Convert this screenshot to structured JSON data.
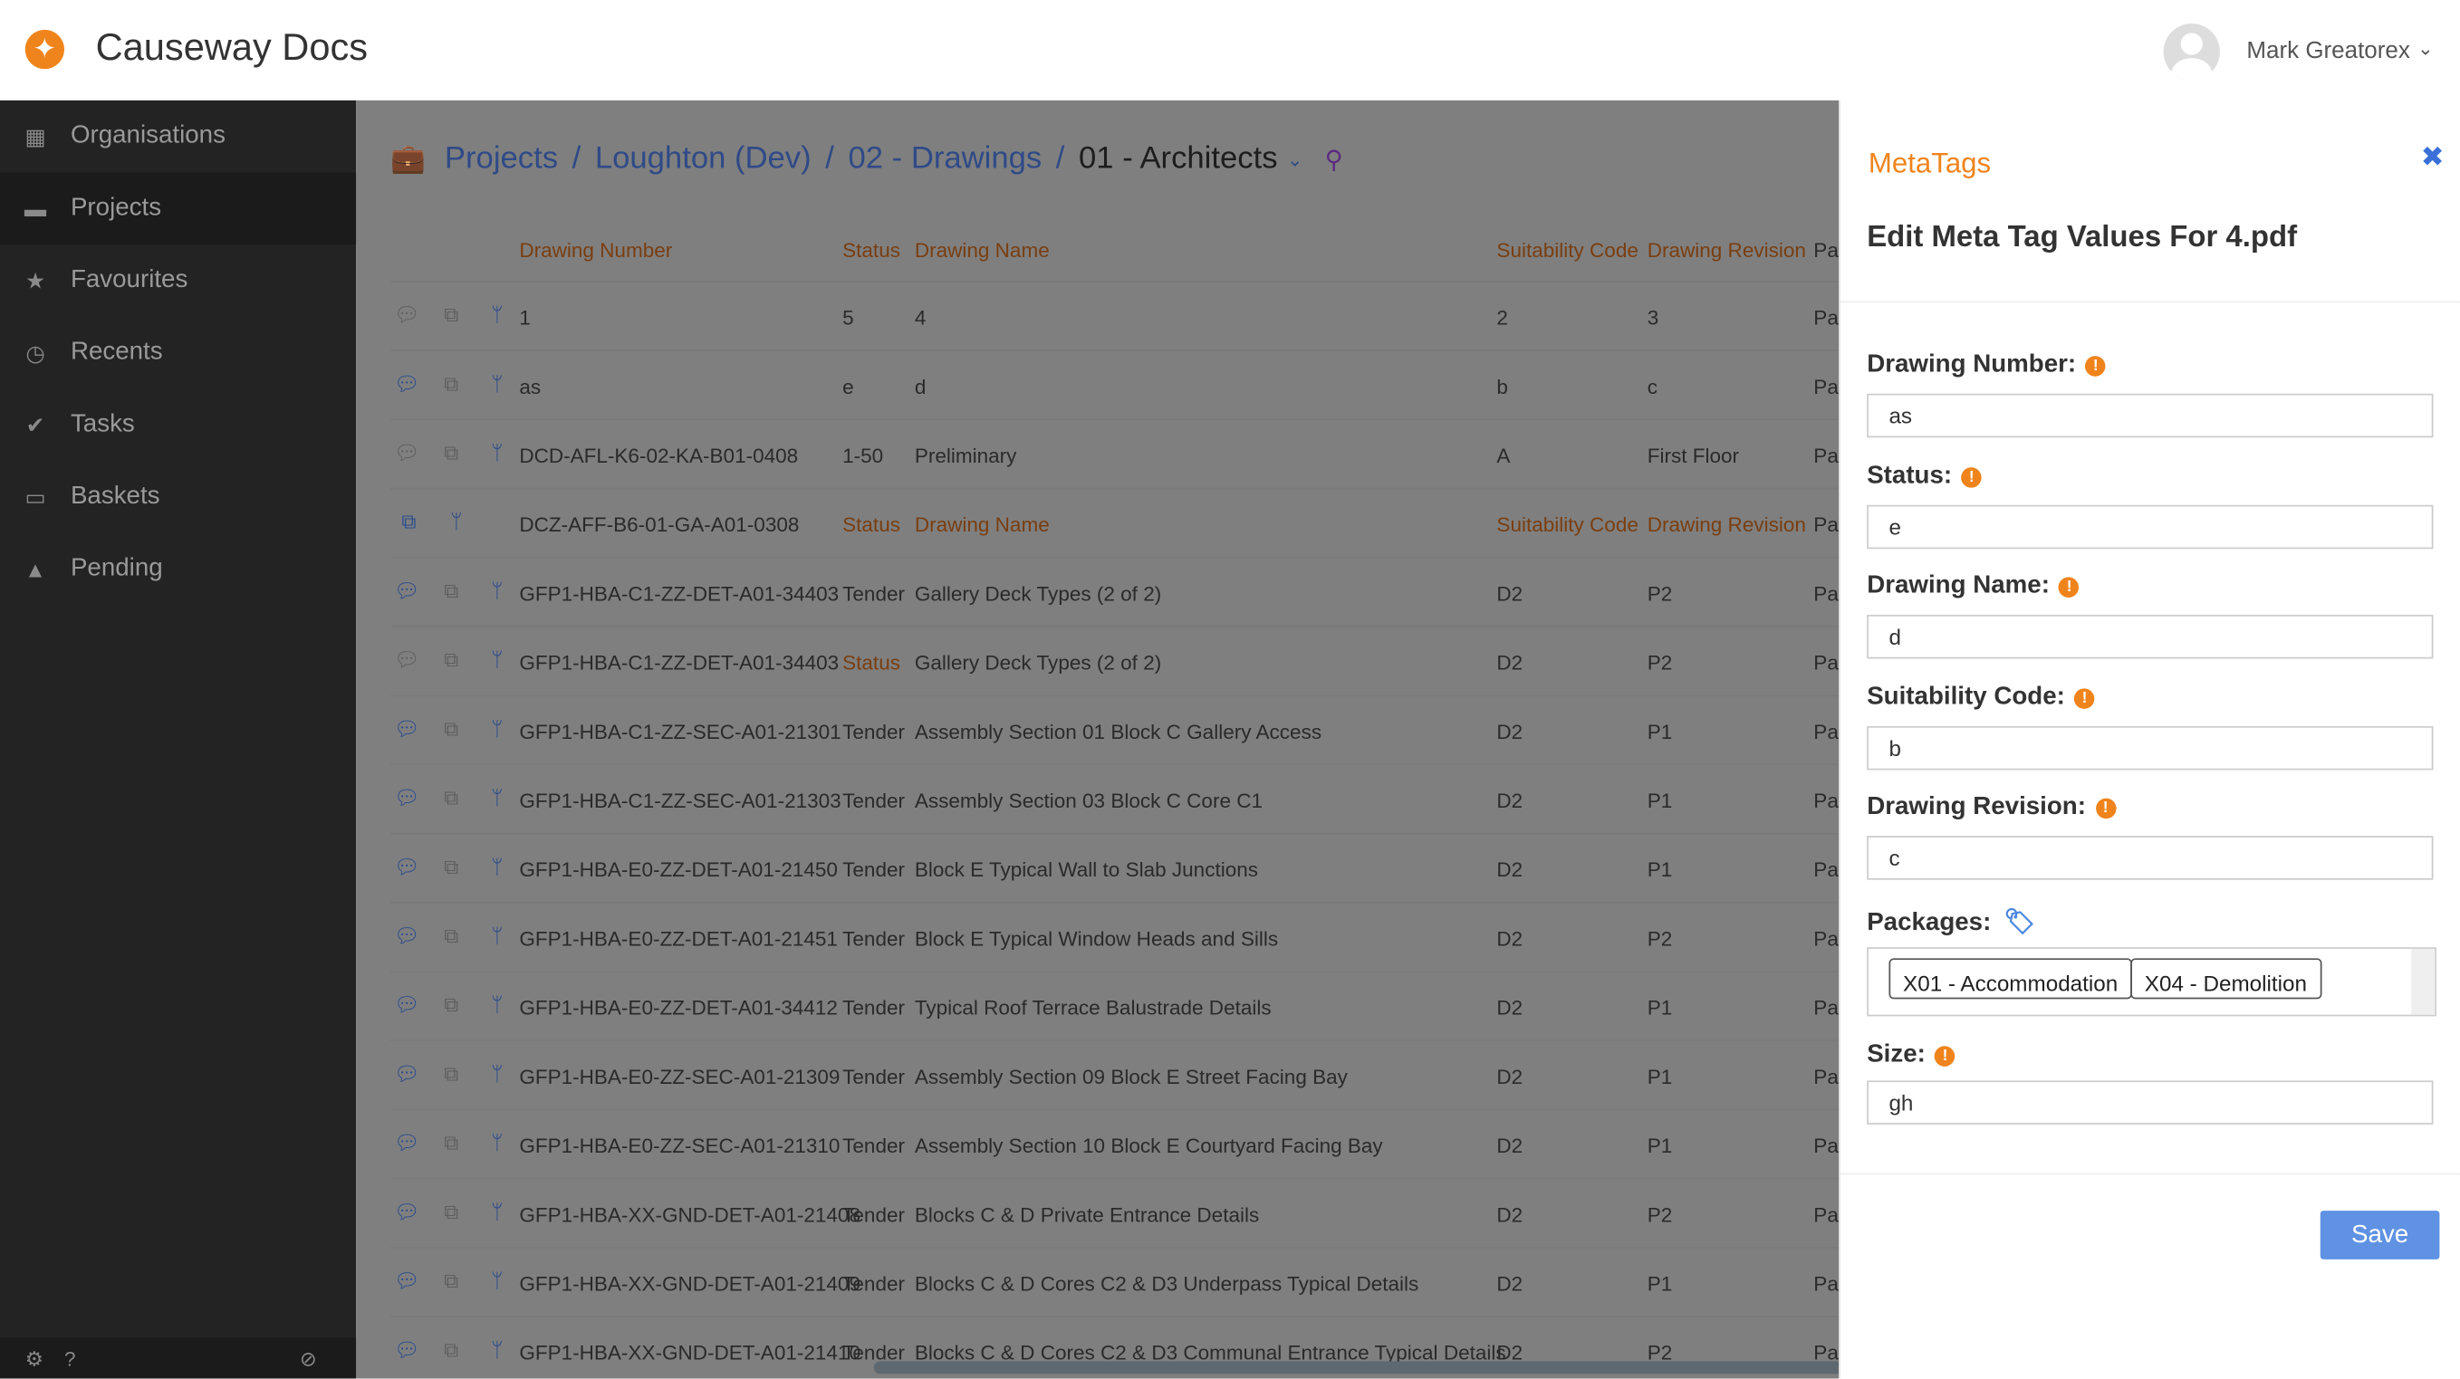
{
  "app": {
    "title": "Causeway Docs",
    "user": "Mark Greatorex"
  },
  "sidebar": {
    "items": [
      {
        "label": "Organisations",
        "icon": "building-icon"
      },
      {
        "label": "Projects",
        "icon": "briefcase-icon",
        "active": true
      },
      {
        "label": "Favourites",
        "icon": "star-icon"
      },
      {
        "label": "Recents",
        "icon": "clock-icon"
      },
      {
        "label": "Tasks",
        "icon": "check-icon"
      },
      {
        "label": "Baskets",
        "icon": "inbox-icon"
      },
      {
        "label": "Pending",
        "icon": "warning-icon"
      }
    ]
  },
  "breadcrumb": {
    "items": [
      "Projects",
      "Loughton (Dev)",
      "02 - Drawings"
    ],
    "current": "01 - Architects"
  },
  "table": {
    "columns": [
      "Drawing Number",
      "Status",
      "Drawing Name",
      "Suitability Code",
      "Drawing Revision",
      "Pa"
    ],
    "rows": [
      {
        "chat": "gray",
        "cells": [
          "1",
          "5",
          "4",
          "2",
          "3",
          "Pa"
        ]
      },
      {
        "chat": "blue",
        "cells": [
          "as",
          "e",
          "d",
          "b",
          "c",
          "Pa"
        ]
      },
      {
        "chat": "gray",
        "cells": [
          "DCD-AFL-K6-02-KA-B01-0408",
          "1-50",
          "Preliminary",
          "A",
          "First Floor",
          "Pa"
        ]
      },
      {
        "chat": "none",
        "cells": [
          "DCZ-AFF-B6-01-GA-A01-0308",
          "Status",
          "Drawing Name",
          "Suitability Code",
          "Drawing Revision",
          "Pa"
        ],
        "orange": [
          1,
          2,
          3,
          4
        ]
      },
      {
        "chat": "blue",
        "cells": [
          "GFP1-HBA-C1-ZZ-DET-A01-34403",
          "Tender",
          "Gallery Deck Types (2 of 2)",
          "D2",
          "P2",
          "Pa"
        ]
      },
      {
        "chat": "gray",
        "cells": [
          "GFP1-HBA-C1-ZZ-DET-A01-34403",
          "Status",
          "Gallery Deck Types (2 of 2)",
          "D2",
          "P2",
          "Pa"
        ],
        "orange": [
          1
        ]
      },
      {
        "chat": "blue",
        "cells": [
          "GFP1-HBA-C1-ZZ-SEC-A01-21301",
          "Tender",
          "Assembly Section 01 Block C Gallery Access",
          "D2",
          "P1",
          "Pa"
        ]
      },
      {
        "chat": "blue",
        "cells": [
          "GFP1-HBA-C1-ZZ-SEC-A01-21303",
          "Tender",
          "Assembly Section 03 Block C Core C1",
          "D2",
          "P1",
          "Pa"
        ]
      },
      {
        "chat": "blue",
        "cells": [
          "GFP1-HBA-E0-ZZ-DET-A01-21450",
          "Tender",
          "Block E Typical Wall to Slab Junctions",
          "D2",
          "P1",
          "Pa"
        ]
      },
      {
        "chat": "blue",
        "cells": [
          "GFP1-HBA-E0-ZZ-DET-A01-21451",
          "Tender",
          "Block E Typical Window Heads and Sills",
          "D2",
          "P2",
          "Pa"
        ]
      },
      {
        "chat": "blue",
        "cells": [
          "GFP1-HBA-E0-ZZ-DET-A01-34412",
          "Tender",
          "Typical Roof Terrace Balustrade Details",
          "D2",
          "P1",
          "Pa"
        ]
      },
      {
        "chat": "blue",
        "cells": [
          "GFP1-HBA-E0-ZZ-SEC-A01-21309",
          "Tender",
          "Assembly Section 09 Block E Street Facing Bay",
          "D2",
          "P1",
          "Pa"
        ]
      },
      {
        "chat": "blue",
        "cells": [
          "GFP1-HBA-E0-ZZ-SEC-A01-21310",
          "Tender",
          "Assembly Section 10 Block E Courtyard Facing Bay",
          "D2",
          "P1",
          "Pa"
        ]
      },
      {
        "chat": "blue",
        "cells": [
          "GFP1-HBA-XX-GND-DET-A01-21408",
          "Tender",
          "Blocks C & D Private Entrance Details",
          "D2",
          "P2",
          "Pa"
        ]
      },
      {
        "chat": "blue",
        "cells": [
          "GFP1-HBA-XX-GND-DET-A01-21409",
          "Tender",
          "Blocks C & D Cores C2 & D3 Underpass Typical Details",
          "D2",
          "P1",
          "Pa"
        ]
      },
      {
        "chat": "blue",
        "cells": [
          "GFP1-HBA-XX-GND-DET-A01-21410",
          "Tender",
          "Blocks C & D Cores C2 & D3 Communal Entrance Typical Details",
          "D2",
          "P2",
          "Pa"
        ]
      }
    ]
  },
  "panel": {
    "title": "MetaTags",
    "subtitle": "Edit Meta Tag Values For 4.pdf",
    "fields": [
      {
        "label": "Drawing Number:",
        "value": "as"
      },
      {
        "label": "Status:",
        "value": "e"
      },
      {
        "label": "Drawing Name:",
        "value": "d"
      },
      {
        "label": "Suitability Code:",
        "value": "b"
      },
      {
        "label": "Drawing Revision:",
        "value": "c"
      }
    ],
    "packages": {
      "label": "Packages:",
      "chips": [
        "X01 - Accommodation",
        "X04 - Demolition"
      ]
    },
    "size": {
      "label": "Size:",
      "value": "gh"
    },
    "save_label": "Save"
  },
  "colors": {
    "accent": "#f0841c",
    "link": "#3a6fd8",
    "save": "#5f92e3"
  }
}
